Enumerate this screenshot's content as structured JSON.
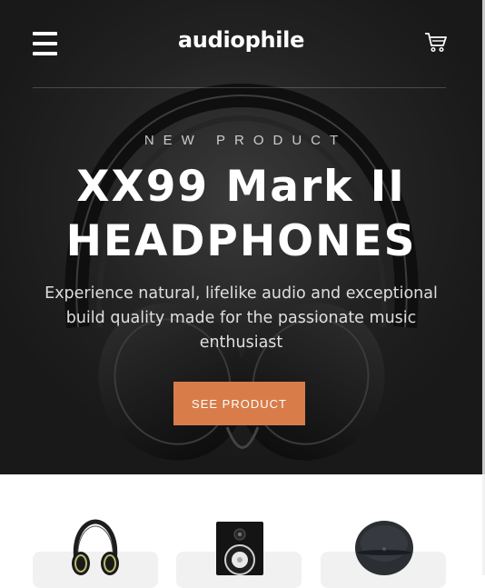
{
  "header": {
    "menu_icon": "hamburger-menu-icon",
    "logo": "audiophile",
    "cart_icon": "shopping-cart-icon"
  },
  "hero": {
    "overline": "NEW PRODUCT",
    "title_line1": "XX99 Mark II",
    "title_line2": "HEADPHONES",
    "description": "Experience natural, lifelike audio and exceptional build quality made for the passionate music enthusiast",
    "cta_label": "SEE PRODUCT",
    "image": "headphones-image"
  },
  "categories": [
    {
      "image": "headphones-thumbnail-image"
    },
    {
      "image": "speaker-thumbnail-image"
    },
    {
      "image": "earphones-thumbnail-image"
    }
  ],
  "colors": {
    "hero_bg": "#191919",
    "accent": "#d87d4a",
    "card_bg": "#f1f1f1"
  }
}
